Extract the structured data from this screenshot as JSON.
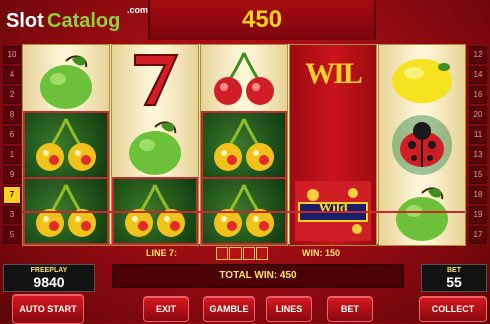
{
  "logo": {
    "part1": "Slot",
    "part2": "Catalog",
    "suffix": ".com"
  },
  "win_banner": {
    "amount": "450"
  },
  "left_lines": [
    "10",
    "4",
    "2",
    "8",
    "6",
    "1",
    "9",
    "7",
    "3",
    "5"
  ],
  "right_lines": [
    "12",
    "14",
    "16",
    "20",
    "11",
    "13",
    "15",
    "18",
    "19",
    "17"
  ],
  "active_line": "7",
  "reels": [
    [
      "green-apple",
      "cherry",
      "cherry"
    ],
    [
      "seven",
      "green-apple",
      "cherry"
    ],
    [
      "cherry",
      "cherry",
      "cherry"
    ],
    [
      "wild-tall",
      "wild-tall",
      "wild"
    ],
    [
      "lemon",
      "ladybug",
      "green-apple"
    ]
  ],
  "wild_label": "Wild",
  "wild_tall_label": "WIL",
  "info": {
    "line_label": "LINE 7:",
    "win_label": "WIN: 150"
  },
  "total_win": "TOTAL WIN: 450",
  "freeplay": {
    "label": "FREEPLAY",
    "value": "9840"
  },
  "bet": {
    "label": "BET",
    "value": "55"
  },
  "buttons": {
    "auto_start": "AUTO START",
    "exit": "EXIT",
    "gamble": "GAMBLE",
    "lines": "LINES",
    "bet": "BET",
    "collect": "COLLECT"
  },
  "colors": {
    "accent": "#ffd21f",
    "background": "#c8141a"
  }
}
